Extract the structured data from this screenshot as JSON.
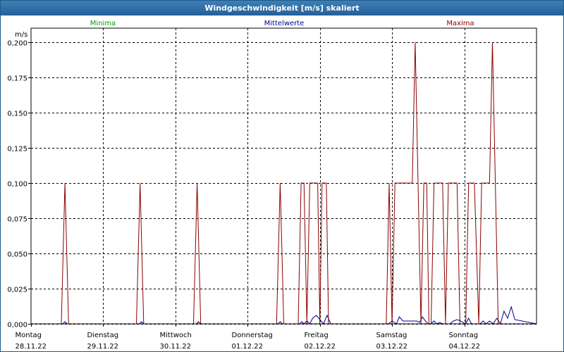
{
  "window": {
    "title": "Windgeschwindigkeit [m/s] skaliert"
  },
  "colors": {
    "minima": "#00a000",
    "mittelwerte": "#000090",
    "maxima": "#8b0000",
    "grid": "#000000",
    "title_bar": "#2a679e"
  },
  "chart_data": {
    "type": "line",
    "title": "Windgeschwindigkeit [m/s] skaliert",
    "ylabel": "m/s",
    "xlabel": "",
    "ylim": [
      0,
      0.21
    ],
    "xlim": [
      0,
      7
    ],
    "y_ticks": [
      "0,000",
      "0,025",
      "0,050",
      "0,075",
      "0,100",
      "0,125",
      "0,150",
      "0,175",
      "0,200"
    ],
    "y_tick_values": [
      0,
      0.025,
      0.05,
      0.075,
      0.1,
      0.125,
      0.15,
      0.175,
      0.2
    ],
    "x_ticks": [
      {
        "day": "Montag",
        "date": "28.11.22"
      },
      {
        "day": "Dienstag",
        "date": "29.11.22"
      },
      {
        "day": "Mittwoch",
        "date": "30.11.22"
      },
      {
        "day": "Donnerstag",
        "date": "01.12.22"
      },
      {
        "day": "Freitag",
        "date": "02.12.22"
      },
      {
        "day": "Samstag",
        "date": "03.12.22"
      },
      {
        "day": "Sonntag",
        "date": "04.12.22"
      }
    ],
    "grid": true,
    "legend_placement": "top",
    "series": [
      {
        "name": "Minima",
        "color": "#00a000",
        "x": [
          0,
          7
        ],
        "y": [
          0,
          0
        ]
      },
      {
        "name": "Mittelwerte",
        "color": "#000090",
        "x": [
          0,
          0.44,
          0.47,
          0.5,
          1.5,
          1.53,
          1.56,
          2.29,
          2.32,
          2.35,
          3.42,
          3.45,
          3.48,
          3.72,
          3.75,
          3.78,
          3.82,
          3.86,
          3.9,
          3.95,
          4.0,
          4.05,
          4.1,
          4.15,
          4.95,
          5.0,
          5.06,
          5.1,
          5.15,
          5.2,
          5.25,
          5.3,
          5.34,
          5.38,
          5.42,
          5.46,
          5.5,
          5.54,
          5.58,
          5.62,
          5.66,
          5.7,
          5.8,
          5.85,
          5.9,
          5.95,
          6.02,
          6.06,
          6.1,
          6.22,
          6.26,
          6.3,
          6.35,
          6.4,
          6.45,
          6.5,
          6.55,
          6.6,
          6.65,
          6.7,
          7
        ],
        "y": [
          0,
          0,
          0.0015,
          0,
          0,
          0.0015,
          0,
          0,
          0.0015,
          0,
          0,
          0.0015,
          0,
          0,
          0.0015,
          0,
          0.002,
          0,
          0.004,
          0.006,
          0.003,
          0,
          0.006,
          0,
          0,
          0.002,
          0,
          0.005,
          0.002,
          0.002,
          0.002,
          0.002,
          0.002,
          0.001,
          0.005,
          0.002,
          0,
          0,
          0.002,
          0,
          0.001,
          0,
          0,
          0.002,
          0.003,
          0.002,
          0,
          0.004,
          0,
          0,
          0.002,
          0,
          0.002,
          0,
          0.004,
          0,
          0.009,
          0.004,
          0.012,
          0.003,
          0
        ]
      },
      {
        "name": "Maxima",
        "color": "#8b0000",
        "x": [
          0,
          0.42,
          0.47,
          0.52,
          1.46,
          1.51,
          1.56,
          2.25,
          2.3,
          2.35,
          3.4,
          3.45,
          3.5,
          3.7,
          3.74,
          3.78,
          3.82,
          3.86,
          3.9,
          3.94,
          3.97,
          4.0,
          4.03,
          4.06,
          4.09,
          4.12,
          4.15,
          4.92,
          4.96,
          5.0,
          5.04,
          5.08,
          5.12,
          5.16,
          5.2,
          5.24,
          5.28,
          5.32,
          5.36,
          5.4,
          5.44,
          5.48,
          5.51,
          5.54,
          5.58,
          5.62,
          5.66,
          5.7,
          5.74,
          5.78,
          5.82,
          5.86,
          5.9,
          5.94,
          5.98,
          6.02,
          6.06,
          6.1,
          6.14,
          6.2,
          6.24,
          6.28,
          6.31,
          6.35,
          6.39,
          6.43,
          6.47,
          6.51,
          6.55,
          6.59,
          6.63,
          6.67,
          6.71,
          6.75,
          7
        ],
        "y": [
          0,
          0,
          0.1,
          0,
          0,
          0.1,
          0,
          0,
          0.1,
          0,
          0,
          0.1,
          0,
          0,
          0.1,
          0.1,
          0,
          0.1,
          0.1,
          0.1,
          0.1,
          0,
          0.1,
          0.1,
          0.1,
          0,
          0,
          0,
          0.1,
          0,
          0.1,
          0.1,
          0.1,
          0.1,
          0.1,
          0.1,
          0.1,
          0.2,
          0.1,
          0,
          0.1,
          0.1,
          0,
          0,
          0.1,
          0.1,
          0.1,
          0.1,
          0,
          0.1,
          0.1,
          0.1,
          0.1,
          0,
          0,
          0,
          0.1,
          0.1,
          0.1,
          0,
          0.1,
          0.1,
          0.1,
          0.1,
          0.2,
          0.1,
          0,
          0,
          0,
          0,
          0,
          0,
          0,
          0,
          0
        ]
      }
    ]
  }
}
